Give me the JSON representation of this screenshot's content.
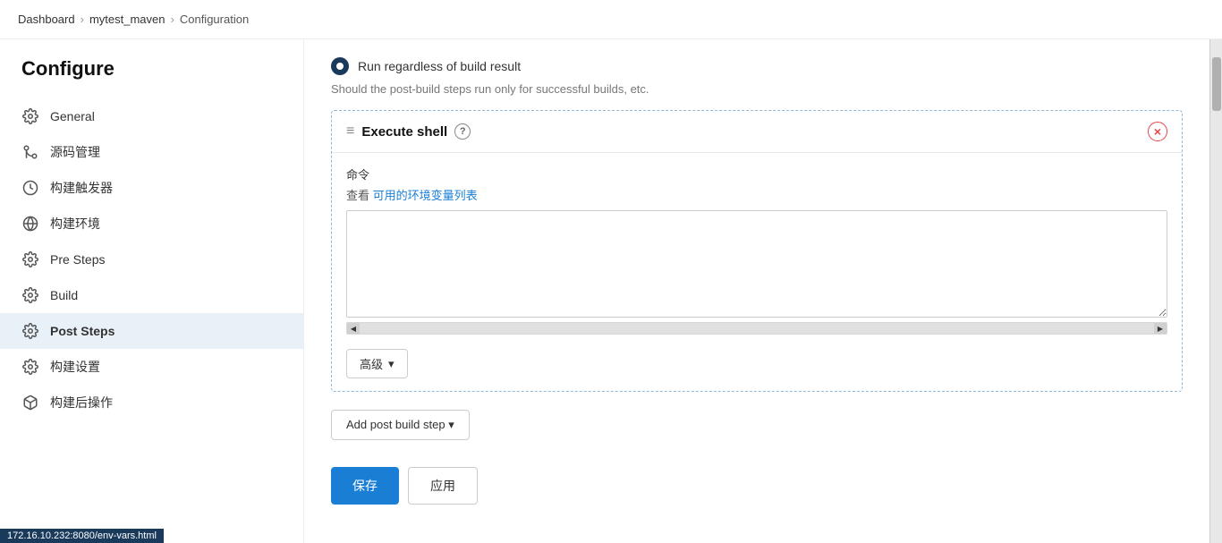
{
  "breadcrumb": {
    "items": [
      {
        "label": "Dashboard",
        "href": "#"
      },
      {
        "label": "mytest_maven",
        "href": "#"
      },
      {
        "label": "Configuration",
        "href": "#"
      }
    ]
  },
  "sidebar": {
    "title": "Configure",
    "items": [
      {
        "id": "general",
        "label": "General",
        "icon": "gear"
      },
      {
        "id": "source-code",
        "label": "源码管理",
        "icon": "source"
      },
      {
        "id": "build-triggers",
        "label": "构建触发器",
        "icon": "clock"
      },
      {
        "id": "build-env",
        "label": "构建环境",
        "icon": "globe"
      },
      {
        "id": "pre-steps",
        "label": "Pre Steps",
        "icon": "gear"
      },
      {
        "id": "build",
        "label": "Build",
        "icon": "gear"
      },
      {
        "id": "post-steps",
        "label": "Post Steps",
        "icon": "gear",
        "active": true
      },
      {
        "id": "build-settings",
        "label": "构建设置",
        "icon": "gear"
      },
      {
        "id": "post-build",
        "label": "构建后操作",
        "icon": "cube"
      }
    ]
  },
  "content": {
    "run_regardless_label": "Run regardless of build result",
    "run_regardless_desc": "Should the post-build steps run only for successful builds, etc.",
    "execute_shell": {
      "title": "Execute shell",
      "help_icon": "?",
      "close_icon": "×",
      "field_label": "命令",
      "field_subtext_pre": "查看",
      "field_subtext_link": "可用的环境变量列表",
      "command_value": "",
      "command_placeholder": ""
    },
    "advanced_button": "高级",
    "add_step_button": "Add post build step ▾",
    "save_button": "保存",
    "apply_button": "应用"
  },
  "status_bar": {
    "url": "172.16.10.232:8080/env-vars.html"
  }
}
